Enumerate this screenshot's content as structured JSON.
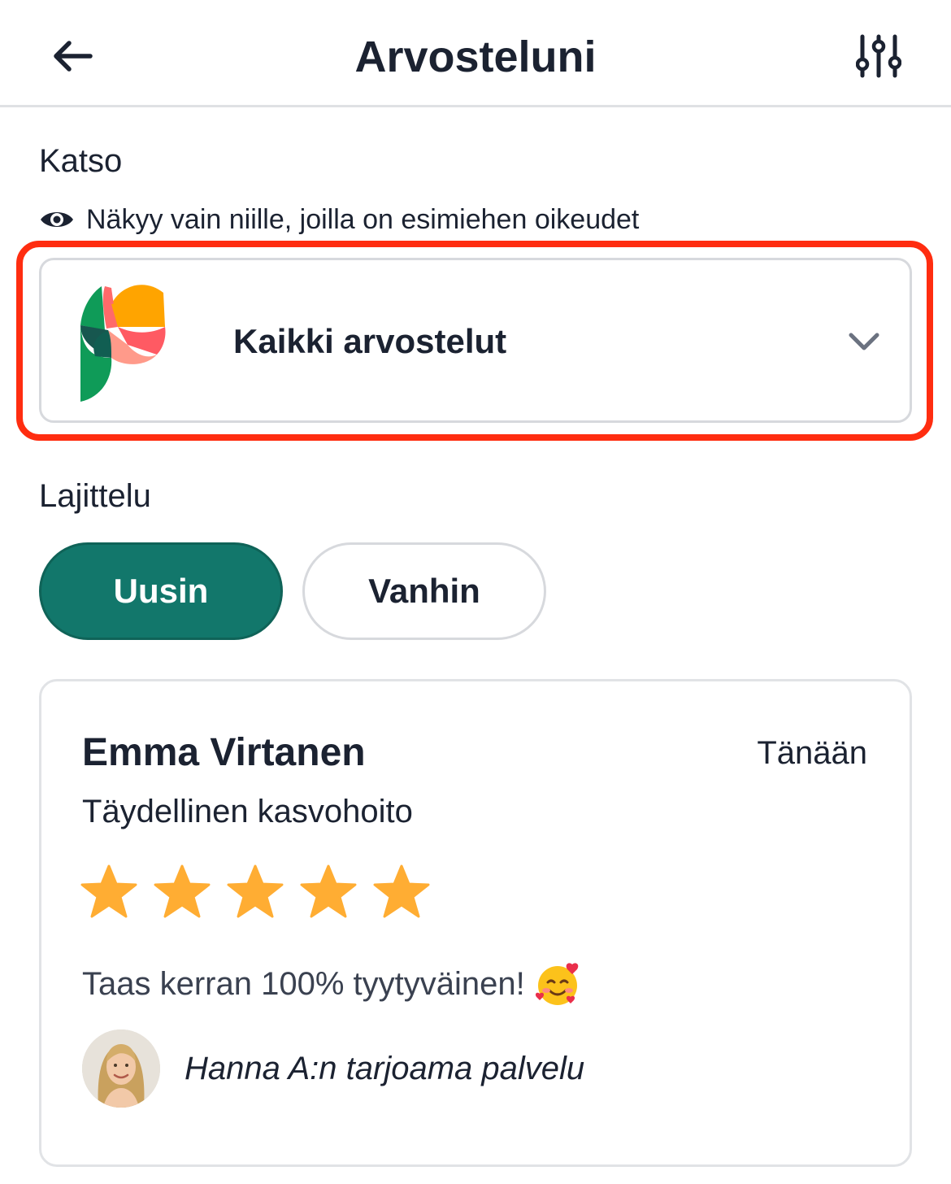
{
  "header": {
    "title": "Arvosteluni",
    "back_icon": "arrow-left-icon",
    "filter_icon": "sliders-icon"
  },
  "view": {
    "label": "Katso",
    "visibility_note": "Näkyy vain niille, joilla on esimiehen oikeudet",
    "visibility_icon": "eye-icon",
    "dropdown": {
      "selected": "Kaikki arvostelut",
      "icon": "chevron-down-icon"
    },
    "highlight_color": "#ff2d10"
  },
  "sorting": {
    "label": "Lajittelu",
    "options": [
      "Uusin",
      "Vanhin"
    ],
    "selected": "Uusin",
    "accent_color": "#12776b"
  },
  "review": {
    "reviewer": "Emma Virtanen",
    "date": "Tänään",
    "service": "Täydellinen kasvohoito",
    "rating": 5,
    "rating_max": 5,
    "star_color": "#ffad33",
    "text": "Taas kerran 100% tyytyväinen!",
    "emoji": "smiling-face-with-hearts",
    "provider": "Hanna A:n tarjoama palvelu"
  }
}
